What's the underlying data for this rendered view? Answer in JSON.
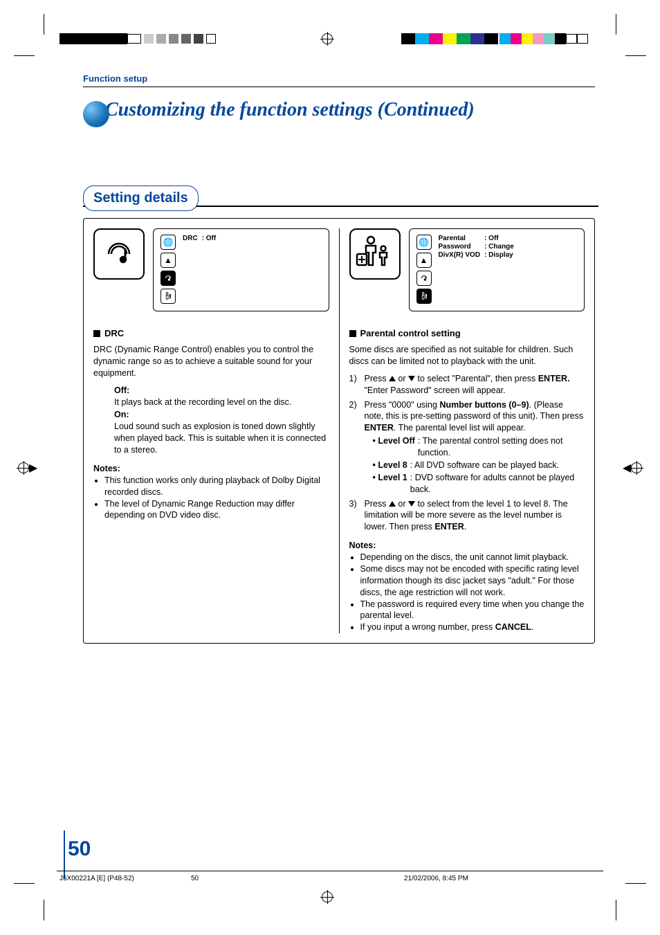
{
  "header": {
    "section_label": "Function setup",
    "page_title": "Customizing the function settings (Continued)"
  },
  "setting_details_label": "Setting details",
  "left": {
    "osd": {
      "items": [
        {
          "label": "DRC",
          "value": ": Off"
        }
      ]
    },
    "heading": "DRC",
    "intro": "DRC (Dynamic Range Control) enables you to control the dynamic range so as to achieve a suitable sound for your equipment.",
    "off_label": "Off:",
    "off_text": "It plays back at the recording level on the disc.",
    "on_label": "On:",
    "on_text": "Loud sound such as explosion is toned down slightly when played back. This is suitable when it is connected to a stereo.",
    "notes_label": "Notes:",
    "notes": [
      "This function works only during playback of Dolby Digital recorded discs.",
      "The level of Dynamic Range Reduction may differ depending on DVD video disc."
    ]
  },
  "right": {
    "osd": {
      "items": [
        {
          "label": "Parental",
          "value": ": Off"
        },
        {
          "label": "Password",
          "value": ": Change"
        },
        {
          "label": "DivX(R) VOD",
          "value": ": Display"
        }
      ]
    },
    "heading": "Parental control setting",
    "intro": "Some discs are specified as not suitable for children. Such discs can be limited not to playback with the unit.",
    "step1_a": "Press ",
    "step1_b": " or ",
    "step1_c": " to select \"Parental\", then press ",
    "step1_enter": "ENTER.",
    "step1_d": " \"Enter Password\" screen will appear.",
    "step2_a": "Press \"0000\" using ",
    "step2_nb": "Number buttons (0–9)",
    "step2_b": ". (Please note, this is pre-setting password of this unit). Then press ",
    "step2_enter": "ENTER",
    "step2_c": ". The parental level list will appear.",
    "levels": [
      {
        "label": "• Level Off",
        "text": ": The parental control setting does not function."
      },
      {
        "label": "• Level 8",
        "text": ":   All DVD software can be played back."
      },
      {
        "label": "• Level 1",
        "text": ":   DVD software for adults cannot be played back."
      }
    ],
    "step3_a": "Press ",
    "step3_b": " or ",
    "step3_c": " to select from the level 1 to level 8. The limitation will be more severe as the level number is lower. Then press ",
    "step3_enter": "ENTER",
    "step3_d": ".",
    "notes_label": "Notes:",
    "notes": [
      "Depending on the discs, the unit cannot limit playback.",
      "Some discs may not be encoded with specific rating level information though its disc jacket says \"adult.\" For those discs, the age restriction will not work.",
      "The password is required every time when you change the parental level."
    ],
    "note_cancel_a": "If you input a wrong number, press ",
    "note_cancel_b": "CANCEL",
    "note_cancel_c": "."
  },
  "footer": {
    "page_number": "50",
    "doc_ref": "J5X00221A [E] (P48-52)",
    "center_pg": "50",
    "timestamp": "21/02/2006, 8:45 PM"
  }
}
